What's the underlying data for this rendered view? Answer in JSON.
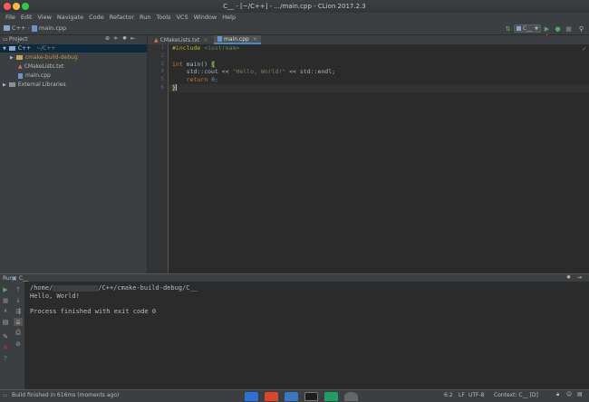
{
  "window": {
    "title": "C__ - [~/C++] - .../main.cpp - CLion 2017.2.3"
  },
  "menu": [
    "File",
    "Edit",
    "View",
    "Navigate",
    "Code",
    "Refactor",
    "Run",
    "Tools",
    "VCS",
    "Window",
    "Help"
  ],
  "breadcrumb": {
    "project": "C++",
    "file": "main.cpp"
  },
  "toolbar": {
    "run_config": "C__"
  },
  "project_panel": {
    "title": "Project"
  },
  "tree": {
    "root": "C++",
    "root_path": "~/C++",
    "build_dir": "cmake-build-debug",
    "cmakelists": "CMakeLists.txt",
    "main": "main.cpp",
    "external": "External Libraries"
  },
  "tabs": [
    {
      "label": "CMakeLists.txt",
      "active": false
    },
    {
      "label": "main.cpp",
      "active": true
    }
  ],
  "editor": {
    "line_numbers": [
      "1",
      "2",
      "3",
      "4",
      "5",
      "6"
    ],
    "l1_kw": "#include",
    "l1_arg": "<iostream>",
    "l3_kw": "int",
    "l3_rest": " main() ",
    "l3_brace": "{",
    "l4_pre": "    std::cout << ",
    "l4_str": "\"Hello, World!\"",
    "l4_post": " << std::endl;",
    "l5_kw": "return",
    "l5_num": "0",
    "l5_post": ";",
    "l6_brace": "}"
  },
  "run_panel": {
    "label": "Run",
    "config": "C__"
  },
  "console": {
    "path_prefix": "/home/",
    "path_suffix": "/C++/cmake-build-debug/C__",
    "output": "Hello, World!",
    "exit": "Process finished with exit code 0"
  },
  "status": {
    "message": "Build finished in 616ms (moments ago)",
    "position": "6:2",
    "line_sep": "LF",
    "encoding": "UTF-8",
    "context": "Context: C__ [D]"
  },
  "colors": {
    "keyword": "#cc7832",
    "string": "#6a8759",
    "number": "#6897bb",
    "preprocessor": "#bbb529",
    "run_green": "#59a869",
    "arrow_red": "#e0332b"
  }
}
